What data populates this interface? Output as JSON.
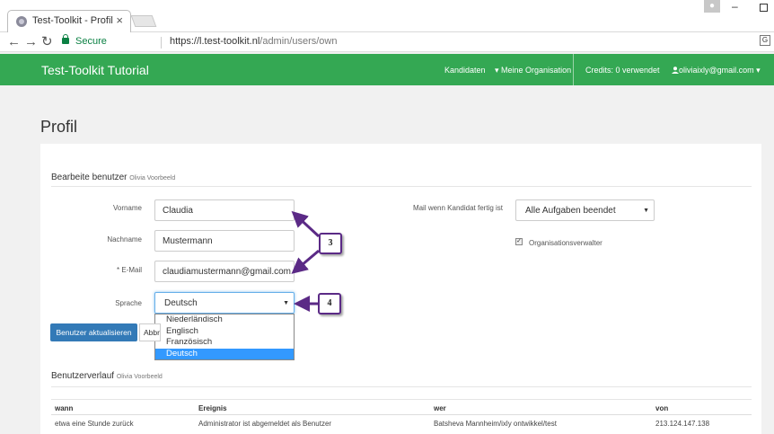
{
  "browser": {
    "tab_title": "Test-Toolkit - Profil",
    "tab_close": "×",
    "secure_label": "Secure",
    "url_host": "https://l.test-toolkit.nl",
    "url_path": "/admin/users/own",
    "back_icon": "←",
    "forward_icon": "→",
    "reload_icon": "↻",
    "minimize_icon": "–",
    "translate_glyph": "G"
  },
  "navbar": {
    "brand": "Test-Toolkit Tutorial",
    "links": [
      "Kandidaten",
      "Meine Organisation"
    ],
    "credits": "Credits: 0 verwendet",
    "user": "oliviaixly@gmail.com",
    "color": "#34a853"
  },
  "page": {
    "title": "Profil"
  },
  "form": {
    "section_title": "Bearbeite benutzer",
    "section_sub": "Olivia Voorbeeld",
    "fields": {
      "vorname_label": "Vorname",
      "vorname_value": "Claudia",
      "nachname_label": "Nachname",
      "nachname_value": "Mustermann",
      "email_label": "E-Mail",
      "email_required": "*",
      "email_value": "claudiamustermann@gmail.com",
      "sprache_label": "Sprache",
      "sprache_value": "Deutsch",
      "mail_label": "Mail wenn Kandidat fertig ist",
      "mail_value": "Alle Aufgaben beendet",
      "checkbox_label": "Organisationsverwalter",
      "checkbox_checked": true
    },
    "language_options": [
      "Niederländisch",
      "Englisch",
      "Französisch",
      "Deutsch"
    ],
    "selected_option": "Deutsch",
    "update_button": "Benutzer aktualisieren",
    "cancel_button": "Abbrechen"
  },
  "history": {
    "title": "Benutzerverlauf",
    "sub": "Olivia Voorbeeld",
    "columns": [
      "wann",
      "Ereignis",
      "wer",
      "von"
    ],
    "rows": [
      [
        "etwa eine Stunde zurück",
        "Administrator ist abgemeldet als Benutzer",
        "Batsheva Mannheim/ixly ontwikkel/test",
        "213.124.147.138"
      ]
    ]
  },
  "callouts": {
    "a": "3",
    "b": "4",
    "color": "#5b2a86"
  }
}
